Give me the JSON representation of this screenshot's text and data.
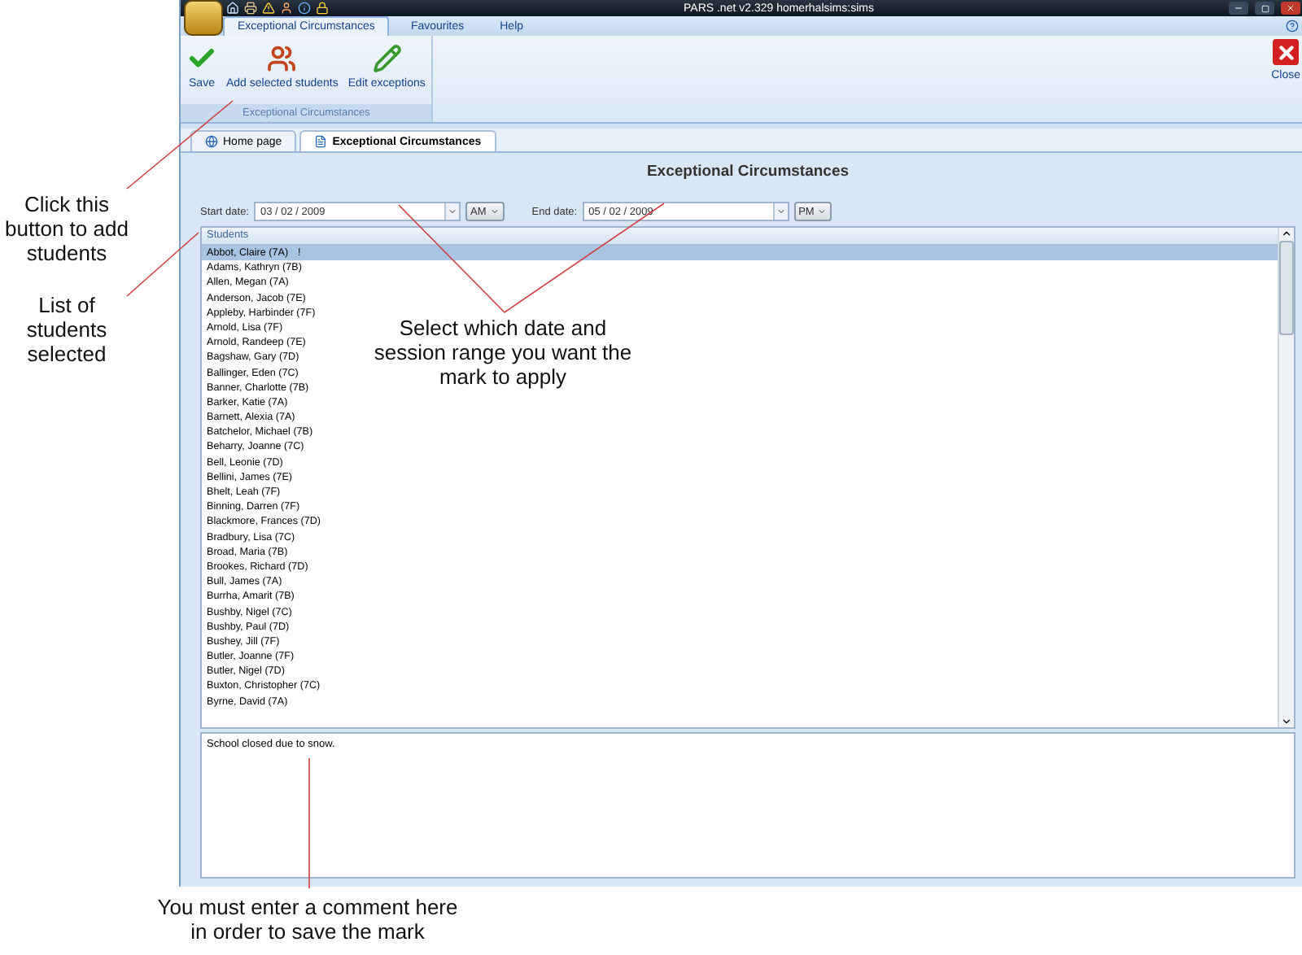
{
  "window": {
    "title": "PARS .net v2.329  homerhalsims:sims"
  },
  "ribbon": {
    "tabs": [
      {
        "label": "Exceptional Circumstances",
        "selected": true
      },
      {
        "label": "Favourites",
        "selected": false
      },
      {
        "label": "Help",
        "selected": false
      }
    ],
    "buttons": [
      {
        "label": "Save",
        "kind": "save"
      },
      {
        "label": "Add selected students",
        "kind": "add"
      },
      {
        "label": "Edit exceptions",
        "kind": "edit"
      }
    ],
    "group_label": "Exceptional Circumstances",
    "close": "Close"
  },
  "doc_tabs": [
    {
      "label": "Home page",
      "kind": "home",
      "selected": false
    },
    {
      "label": "Exceptional Circumstances",
      "kind": "doc",
      "selected": true
    }
  ],
  "panel": {
    "title": "Exceptional Circumstances",
    "start_label": "Start date:",
    "start_date": "03 / 02 / 2009",
    "start_session": "AM",
    "end_label": "End date:",
    "end_date": "05 / 02 / 2009",
    "end_session": "PM"
  },
  "students": {
    "header": "Students",
    "rows": [
      {
        "name": "Abbot, Claire (7A)",
        "flag": "!",
        "selected": true
      },
      {
        "name": "Adams, Kathryn (7B)",
        "selected": false
      },
      {
        "name": "Allen, Megan (7A)",
        "selected": false
      },
      {
        "name": "Anderson, Jacob (7E)",
        "selected": false
      },
      {
        "name": "Appleby, Harbinder (7F)",
        "selected": false
      },
      {
        "name": "Arnold, Lisa (7F)",
        "selected": false
      },
      {
        "name": "Arnold, Randeep (7E)",
        "selected": false
      },
      {
        "name": "Bagshaw, Gary (7D)",
        "selected": false
      },
      {
        "name": "Ballinger, Eden (7C)",
        "selected": false
      },
      {
        "name": "Banner, Charlotte (7B)",
        "selected": false
      },
      {
        "name": "Barker, Katie (7A)",
        "selected": false
      },
      {
        "name": "Barnett, Alexia (7A)",
        "selected": false
      },
      {
        "name": "Batchelor, Michael (7B)",
        "selected": false
      },
      {
        "name": "Beharry, Joanne (7C)",
        "selected": false
      },
      {
        "name": "Bell, Leonie (7D)",
        "selected": false
      },
      {
        "name": "Bellini, James (7E)",
        "selected": false
      },
      {
        "name": "Bhelt, Leah (7F)",
        "selected": false
      },
      {
        "name": "Binning, Darren (7F)",
        "selected": false
      },
      {
        "name": "Blackmore, Frances (7D)",
        "selected": false
      },
      {
        "name": "Bradbury, Lisa (7C)",
        "selected": false
      },
      {
        "name": "Broad, Maria (7B)",
        "selected": false
      },
      {
        "name": "Brookes, Richard (7D)",
        "selected": false
      },
      {
        "name": "Bull, James (7A)",
        "selected": false
      },
      {
        "name": "Burrha, Amarit (7B)",
        "selected": false
      },
      {
        "name": "Bushby, Nigel (7C)",
        "selected": false
      },
      {
        "name": "Bushby, Paul (7D)",
        "selected": false
      },
      {
        "name": "Bushey, Jill (7F)",
        "selected": false
      },
      {
        "name": "Butler, Joanne (7F)",
        "selected": false
      },
      {
        "name": "Butler, Nigel (7D)",
        "selected": false
      },
      {
        "name": "Buxton, Christopher (7C)",
        "selected": false
      },
      {
        "name": "Byrne, David (7A)",
        "selected": false
      }
    ]
  },
  "comment": "School closed due to snow.",
  "annotations": [
    "Click this button to add students",
    "List of students selected",
    "Select which date and session range you want the mark to apply",
    "You must enter a comment here in order to save the mark"
  ]
}
